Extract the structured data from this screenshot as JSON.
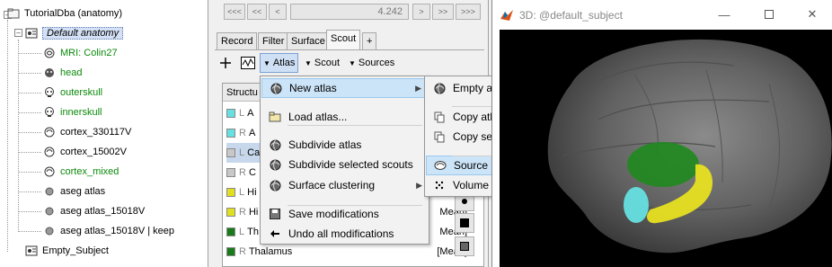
{
  "tree": {
    "root": "TutorialDba (anatomy)",
    "subject": "Default anatomy",
    "items": [
      {
        "label": "MRI: Colin27",
        "green": true,
        "icon": "brain-icon"
      },
      {
        "label": "head",
        "green": true,
        "icon": "head-icon"
      },
      {
        "label": "outerskull",
        "green": true,
        "icon": "skull-icon"
      },
      {
        "label": "innerskull",
        "green": true,
        "icon": "skull-icon"
      },
      {
        "label": "cortex_330117V",
        "green": false,
        "icon": "cortex-icon"
      },
      {
        "label": "cortex_15002V",
        "green": false,
        "icon": "cortex-icon"
      },
      {
        "label": "cortex_mixed",
        "green": true,
        "icon": "cortex-icon"
      },
      {
        "label": "aseg atlas",
        "green": false,
        "icon": "dot-icon"
      },
      {
        "label": "aseg atlas_15018V",
        "green": false,
        "icon": "dot-icon"
      },
      {
        "label": "aseg atlas_15018V | keep",
        "green": false,
        "icon": "dot-icon"
      }
    ],
    "empty_subject": "Empty_Subject"
  },
  "nav": {
    "buttons": [
      "<<<",
      "<<",
      "<",
      ">",
      ">>",
      ">>>"
    ],
    "time_value": "4.242"
  },
  "tabs": [
    "Record",
    "Filter",
    "Surface",
    "Scout",
    "+"
  ],
  "toolbar": {
    "atlas": "Atlas",
    "scout": "Scout",
    "sources": "Sources"
  },
  "structures": {
    "header": "Structu",
    "rows": [
      {
        "hemi": "L",
        "name": "A",
        "color": "#66e0e0",
        "mean": ""
      },
      {
        "hemi": "R",
        "name": "A",
        "color": "#66e0e0",
        "mean": ""
      },
      {
        "hemi": "L",
        "name": "Ca",
        "color": "#c8c8c8",
        "mean": "",
        "selected": true
      },
      {
        "hemi": "R",
        "name": "C",
        "color": "#c8c8c8",
        "mean": ""
      },
      {
        "hemi": "L",
        "name": "Hi",
        "color": "#e0e020",
        "mean": ""
      },
      {
        "hemi": "R",
        "name": "Hi",
        "color": "#e0e020",
        "mean": "Mean]"
      },
      {
        "hemi": "L",
        "name": "Th",
        "color": "#1a7a1a",
        "mean": "Mean]"
      },
      {
        "hemi": "R",
        "name": "Thalamus",
        "color": "#1a7a1a",
        "mean": "[Mean]"
      }
    ]
  },
  "atlas_menu": {
    "items": [
      {
        "label": "New atlas",
        "icon": "globe-icon",
        "submenu": true,
        "highlighted": true
      },
      {
        "label": "Load atlas...",
        "icon": "folder-icon"
      },
      {
        "label": "Subdivide atlas",
        "icon": "globe-icon"
      },
      {
        "label": "Subdivide selected scouts",
        "icon": "globe-icon"
      },
      {
        "label": "Surface clustering",
        "icon": "globe-icon",
        "submenu": true
      },
      {
        "label": "Save modifications",
        "icon": "save-icon"
      },
      {
        "label": "Undo all modifications",
        "icon": "undo-icon"
      }
    ]
  },
  "new_atlas_menu": {
    "items": [
      {
        "label": "Empty atlas",
        "icon": "globe-icon"
      },
      {
        "label": "Copy atlas",
        "icon": "copy-icon"
      },
      {
        "label": "Copy selected scouts",
        "icon": "copy-icon"
      },
      {
        "label": "Source model options",
        "icon": "brain-outline-icon",
        "highlighted": true
      },
      {
        "label": "Volume scouts",
        "icon": "dots-icon"
      }
    ]
  },
  "window3d": {
    "title": "3D: @default_subject"
  }
}
